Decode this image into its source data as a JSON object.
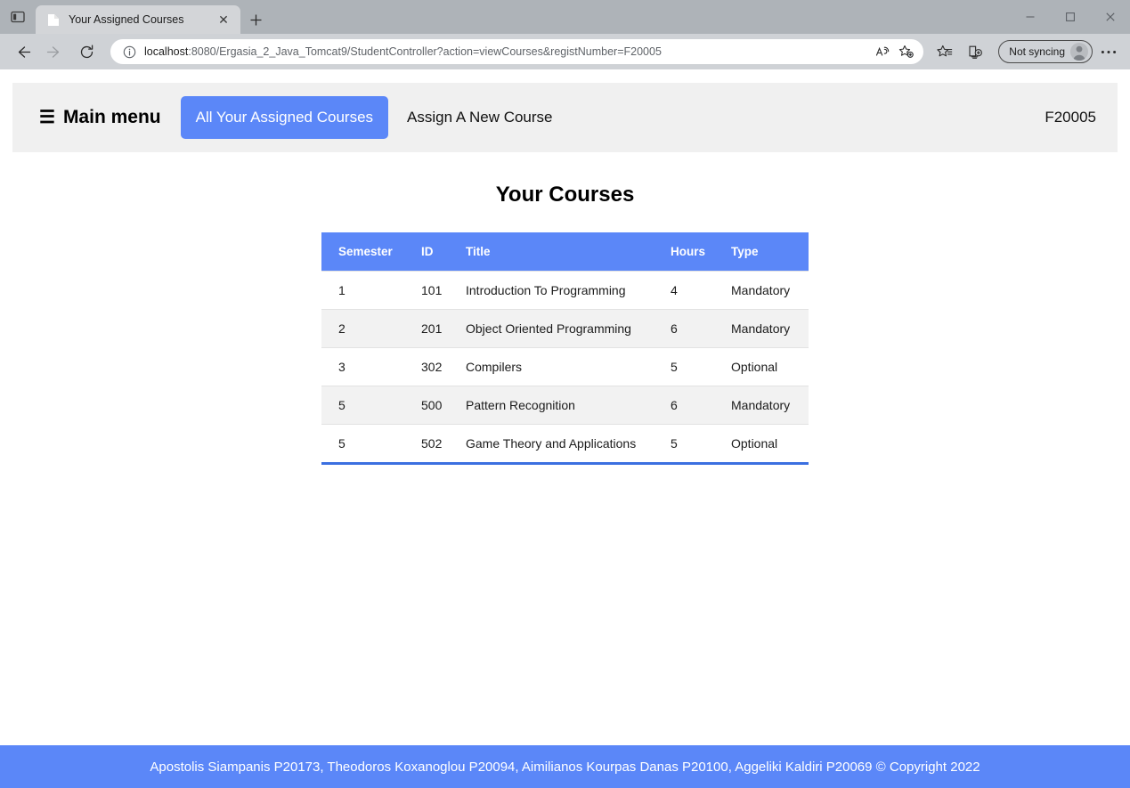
{
  "browser": {
    "tab": {
      "title": "Your Assigned Courses",
      "favicon_name": "document-icon",
      "close_label": "✕"
    },
    "tab_strip_button_name": "tab-actions-icon",
    "new_tab_label": "+",
    "window_controls": {
      "minimize": "─",
      "maximize": "□",
      "close": "✕"
    },
    "toolbar": {
      "back_label": "←",
      "forward_label": "→",
      "refresh_label": "⟳",
      "url_scheme_host": "localhost",
      "url_rest": ":8080/Ergasia_2_Java_Tomcat9/StudentController?action=viewCourses&registNumber=F20005",
      "read_aloud_label": "Aᴺ",
      "add_favorite_name": "add-favorite-icon",
      "favorites_name": "favorites-icon",
      "collections_name": "collections-icon",
      "sync_status": "Not syncing",
      "settings_label": "⋯"
    }
  },
  "nav": {
    "hamburger": "☰",
    "brand": "Main menu",
    "links": [
      {
        "label": "All Your Assigned Courses",
        "active": true
      },
      {
        "label": "Assign A New Course",
        "active": false
      }
    ],
    "user": "F20005"
  },
  "main": {
    "heading": "Your Courses",
    "table": {
      "columns": [
        "Semester",
        "ID",
        "Title",
        "Hours",
        "Type"
      ],
      "rows": [
        {
          "semester": "1",
          "id": "101",
          "title": "Introduction To Programming",
          "hours": "4",
          "type": "Mandatory"
        },
        {
          "semester": "2",
          "id": "201",
          "title": "Object Oriented Programming",
          "hours": "6",
          "type": "Mandatory"
        },
        {
          "semester": "3",
          "id": "302",
          "title": "Compilers",
          "hours": "5",
          "type": "Optional"
        },
        {
          "semester": "5",
          "id": "500",
          "title": "Pattern Recognition",
          "hours": "6",
          "type": "Mandatory"
        },
        {
          "semester": "5",
          "id": "502",
          "title": "Game Theory and Applications",
          "hours": "5",
          "type": "Optional"
        }
      ]
    }
  },
  "footer": {
    "text": "Apostolis Siampanis P20173, Theodoros Koxanoglou P20094, Aimilianos Kourpas Danas P20100, Aggeliki Kaldiri P20069 © Copyright 2022"
  },
  "colors": {
    "accent_blue": "#5b87f8",
    "table_border_blue": "#3b6fe0",
    "nav_bg": "#f0f0f0",
    "stripe": "#f2f2f2"
  }
}
